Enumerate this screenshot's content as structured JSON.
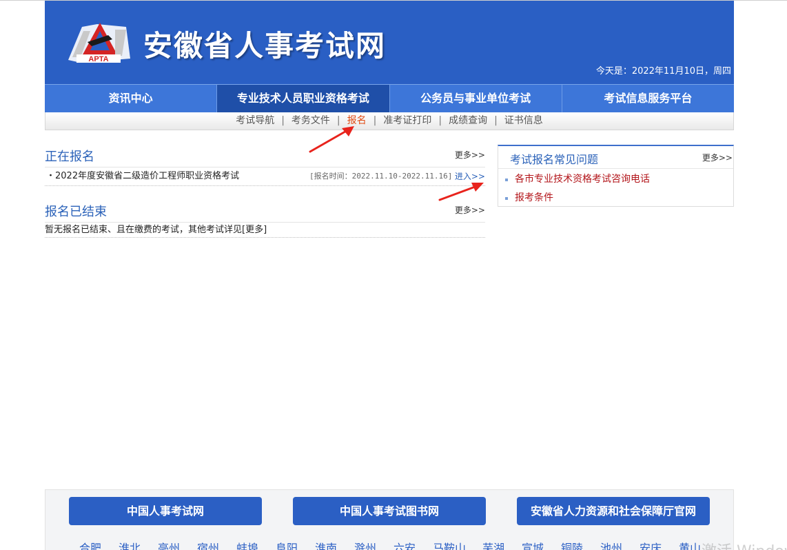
{
  "header": {
    "logo_text": "APTA",
    "title": "安徽省人事考试网",
    "date": "今天是：2022年11月10日，周四"
  },
  "main_nav": [
    {
      "label": "资讯中心"
    },
    {
      "label": "专业技术人员职业资格考试"
    },
    {
      "label": "公务员与事业单位考试"
    },
    {
      "label": "考试信息服务平台"
    }
  ],
  "sub_nav": {
    "items": [
      {
        "label": "考试导航"
      },
      {
        "label": "考务文件"
      },
      {
        "label": "报名"
      },
      {
        "label": "准考证打印"
      },
      {
        "label": "成绩查询"
      },
      {
        "label": "证书信息"
      }
    ],
    "separator": "|"
  },
  "registering": {
    "title": "正在报名",
    "more": "更多>>",
    "items": [
      {
        "name": "・2022年度安徽省二级造价工程师职业资格考试",
        "time": "[报名时间：2022.11.10-2022.11.16]",
        "enter": "进入>>"
      }
    ]
  },
  "ended": {
    "title": "报名已结束",
    "more": "更多>>",
    "note": "暂无报名已结束、且在缴费的考试，其他考试详见[更多]"
  },
  "faq": {
    "title": "考试报名常见问题",
    "more": "更多>>",
    "items": [
      {
        "label": "各市专业技术资格考试咨询电话"
      },
      {
        "label": "报考条件"
      }
    ]
  },
  "footer": {
    "buttons": [
      {
        "label": "中国人事考试网"
      },
      {
        "label": "中国人事考试图书网"
      },
      {
        "label": "安徽省人力资源和社会保障厅官网"
      }
    ],
    "cities": [
      "合肥",
      "淮北",
      "亳州",
      "宿州",
      "蚌埠",
      "阜阳",
      "淮南",
      "滁州",
      "六安",
      "马鞍山",
      "芜湖",
      "宣城",
      "铜陵",
      "池州",
      "安庆",
      "黄山"
    ]
  },
  "watermark": "激活 Windows",
  "colors": {
    "header_blue": "#2a5fc4",
    "nav_blue": "#3d76d9",
    "nav_active": "#1f4fa8",
    "link_blue": "#2b62b9",
    "faq_red": "#b3161b",
    "sub_active": "#e04a12",
    "arrow_red": "#e8231c"
  },
  "icons": [
    "apta-logo-icon",
    "red-arrow-icon"
  ]
}
